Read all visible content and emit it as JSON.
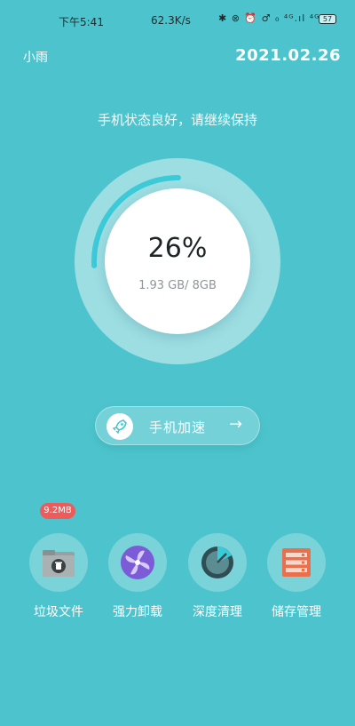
{
  "statusbar": {
    "time": "下午5:41",
    "speed": "62.3K/s",
    "icons_text": "✱ ⊗ ⏰ ♂ ₀ ⁴ᴳ.ıl ⁴ᴳ.ıl",
    "battery": "57"
  },
  "header": {
    "user": "小雨",
    "date": "2021.02.26"
  },
  "status_message": "手机状态良好，请继续保持",
  "memory": {
    "percent_label": "26%",
    "percent": 26,
    "usage_label": "1.93 GB/ 8GB"
  },
  "boost": {
    "label": "手机加速",
    "arrow": "→"
  },
  "tools": [
    {
      "label": "垃圾文件",
      "icon": "trash-folder-icon",
      "badge": "9.2MB"
    },
    {
      "label": "强力卸载",
      "icon": "fan-icon"
    },
    {
      "label": "深度清理",
      "icon": "radar-icon"
    },
    {
      "label": "储存管理",
      "icon": "storage-icon"
    }
  ],
  "colors": {
    "background": "#4dc4cd",
    "accent": "#3ccad8",
    "badge": "#ef5a5a",
    "fan": "#7b5bd6",
    "storage": "#e8704f"
  }
}
